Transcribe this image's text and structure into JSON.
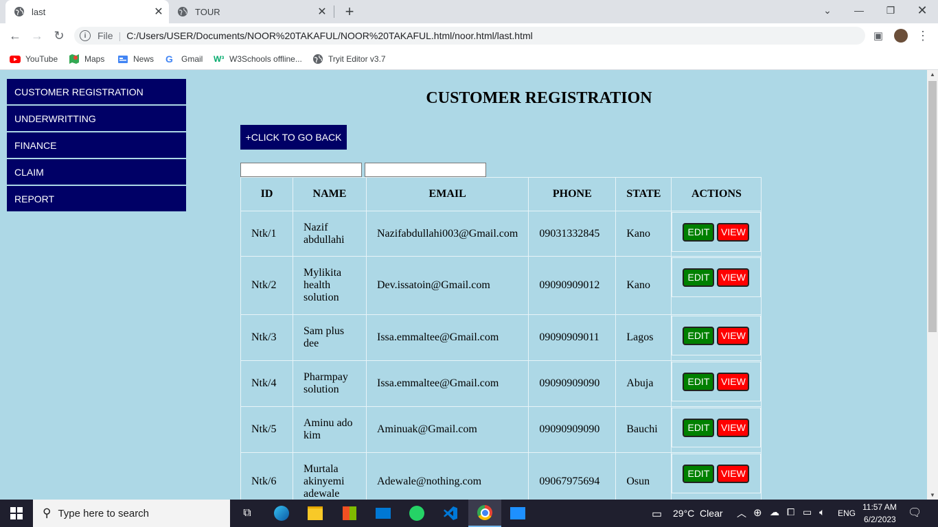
{
  "browser": {
    "tabs": [
      {
        "title": "last",
        "active": true
      },
      {
        "title": "TOUR",
        "active": false
      }
    ],
    "url_prefix": "File",
    "url": "C:/Users/USER/Documents/NOOR%20TAKAFUL/NOOR%20TAKAFUL.html/noor.html/last.html",
    "bookmarks": [
      {
        "label": "YouTube",
        "icon": "youtube-icon"
      },
      {
        "label": "Maps",
        "icon": "maps-icon"
      },
      {
        "label": "News",
        "icon": "news-icon"
      },
      {
        "label": "Gmail",
        "icon": "google-icon"
      },
      {
        "label": "W3Schools offline...",
        "icon": "w3schools-icon"
      },
      {
        "label": "Tryit Editor v3.7",
        "icon": "globe-icon"
      }
    ]
  },
  "sidebar": {
    "items": [
      {
        "label": "CUSTOMER REGISTRATION"
      },
      {
        "label": "UNDERWRITTING"
      },
      {
        "label": "FINANCE"
      },
      {
        "label": "CLAIM"
      },
      {
        "label": "REPORT"
      }
    ]
  },
  "main": {
    "title": "CUSTOMER REGISTRATION",
    "back_label": "+CLICK TO GO BACK",
    "search1_value": "",
    "search2_value": ""
  },
  "table": {
    "headers": [
      "ID",
      "NAME",
      "EMAIL",
      "PHONE",
      "STATE",
      "ACTIONS"
    ],
    "edit_label": "EDIT",
    "view_label": "VIEW",
    "rows": [
      {
        "id": "Ntk/1",
        "name": "Nazif abdullahi",
        "email": "Nazifabdullahi003@Gmail.com",
        "phone": "09031332845",
        "state": "Kano"
      },
      {
        "id": "Ntk/2",
        "name": "Mylikita health solution",
        "email": "Dev.issatoin@Gmail.com",
        "phone": "09090909012",
        "state": "Kano"
      },
      {
        "id": "Ntk/3",
        "name": "Sam plus dee",
        "email": "Issa.emmaltee@Gmail.com",
        "phone": "09090909011",
        "state": "Lagos"
      },
      {
        "id": "Ntk/4",
        "name": "Pharmpay solution",
        "email": "Issa.emmaltee@Gmail.com",
        "phone": "09090909090",
        "state": "Abuja"
      },
      {
        "id": "Ntk/5",
        "name": "Aminu ado kim",
        "email": "Aminuak@Gmail.com",
        "phone": "09090909090",
        "state": "Bauchi"
      },
      {
        "id": "Ntk/6",
        "name": "Murtala akinyemi adewale",
        "email": "Adewale@nothing.com",
        "phone": "09067975694",
        "state": "Osun"
      }
    ]
  },
  "taskbar": {
    "search_placeholder": "Type here to search",
    "weather": "29°C  Clear",
    "lang": "ENG",
    "time": "11:57 AM",
    "date": "6/2/2023"
  },
  "colors": {
    "page_bg": "#add8e6",
    "nav_bg": "#000066",
    "edit_bg": "#008000",
    "view_bg": "#ff0000"
  }
}
